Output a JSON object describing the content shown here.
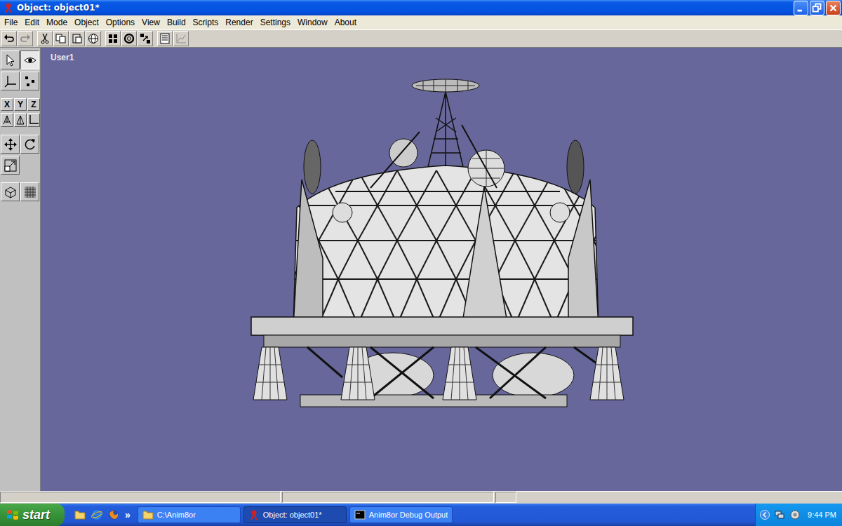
{
  "window": {
    "title": "Object: object01*"
  },
  "menu": [
    "File",
    "Edit",
    "Mode",
    "Object",
    "Options",
    "View",
    "Build",
    "Scripts",
    "Render",
    "Settings",
    "Window",
    "About"
  ],
  "toolbar": [
    [
      {
        "kind": "undo",
        "disabled": false
      },
      {
        "kind": "redo",
        "disabled": true
      }
    ],
    [
      {
        "kind": "cut",
        "disabled": false
      },
      {
        "kind": "copy",
        "disabled": false
      },
      {
        "kind": "paste",
        "disabled": false
      },
      {
        "kind": "globe",
        "disabled": false
      }
    ],
    [
      {
        "kind": "grid",
        "disabled": false
      },
      {
        "kind": "ring",
        "disabled": false
      },
      {
        "kind": "snap",
        "disabled": false
      }
    ],
    [
      {
        "kind": "list",
        "disabled": false
      },
      {
        "kind": "graph",
        "disabled": true
      }
    ]
  ],
  "toolbox": [
    [
      {
        "kind": "arrow",
        "selected": false
      },
      {
        "kind": "eye",
        "selected": true
      }
    ],
    [
      {
        "kind": "axes",
        "selected": false
      },
      {
        "kind": "points",
        "selected": false
      }
    ],
    [
      {
        "kind": "axis",
        "label": "X",
        "selected": false
      },
      {
        "kind": "axis",
        "label": "Y",
        "selected": false
      },
      {
        "kind": "axis",
        "label": "Z",
        "selected": false
      }
    ],
    [
      {
        "kind": "tripod",
        "selected": false
      },
      {
        "kind": "tripod2",
        "selected": false
      },
      {
        "kind": "corner",
        "selected": false
      }
    ],
    [
      {
        "kind": "move",
        "selected": false
      },
      {
        "kind": "rotate",
        "selected": false
      }
    ],
    [
      {
        "kind": "scale",
        "selected": false
      }
    ],
    [
      {
        "kind": "wire",
        "selected": false
      },
      {
        "kind": "solid",
        "selected": false
      }
    ]
  ],
  "viewport": {
    "label": "User1"
  },
  "taskbar": {
    "start": "start",
    "more": "»",
    "tasks": [
      {
        "kind": "folder",
        "label": "C:\\Anim8or",
        "selected": false
      },
      {
        "kind": "app",
        "label": "Object: object01*",
        "selected": true
      },
      {
        "kind": "console",
        "label": "Anim8or Debug Output",
        "selected": false
      }
    ],
    "clock": "9:44 PM"
  }
}
